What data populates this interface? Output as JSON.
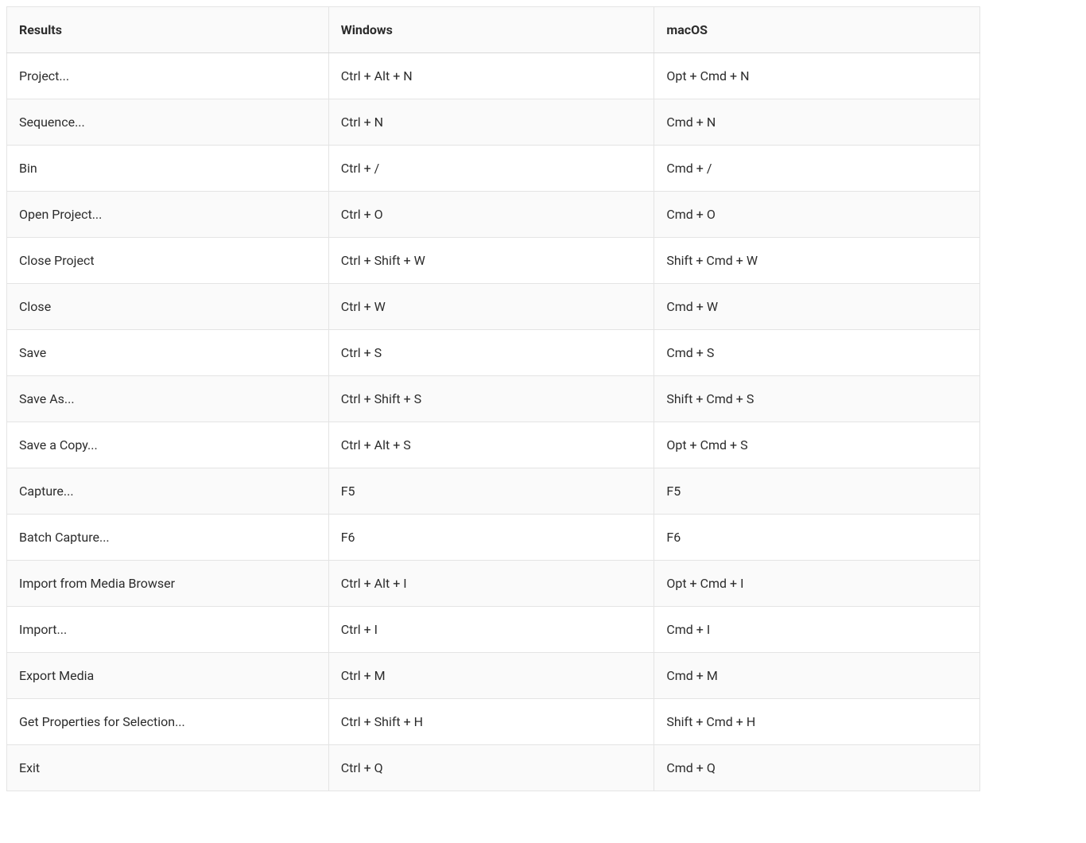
{
  "table": {
    "headers": {
      "results": "Results",
      "windows": "Windows",
      "macos": "macOS"
    },
    "rows": [
      {
        "results": "Project...",
        "windows": "Ctrl + Alt + N",
        "macos": "Opt + Cmd + N"
      },
      {
        "results": "Sequence...",
        "windows": "Ctrl + N",
        "macos": "Cmd + N"
      },
      {
        "results": "Bin",
        "windows": "Ctrl + /",
        "macos": "Cmd + /"
      },
      {
        "results": "Open Project...",
        "windows": "Ctrl + O",
        "macos": "Cmd + O"
      },
      {
        "results": "Close Project",
        "windows": "Ctrl + Shift + W",
        "macos": "Shift + Cmd + W"
      },
      {
        "results": "Close",
        "windows": "Ctrl + W",
        "macos": "Cmd + W"
      },
      {
        "results": "Save",
        "windows": "Ctrl + S",
        "macos": "Cmd + S"
      },
      {
        "results": "Save As...",
        "windows": "Ctrl + Shift + S",
        "macos": "Shift + Cmd + S"
      },
      {
        "results": "Save a Copy...",
        "windows": "Ctrl + Alt + S",
        "macos": "Opt + Cmd + S"
      },
      {
        "results": "Capture...",
        "windows": "F5",
        "macos": "F5"
      },
      {
        "results": "Batch Capture...",
        "windows": "F6",
        "macos": "F6"
      },
      {
        "results": "Import from Media Browser",
        "windows": "Ctrl + Alt + I",
        "macos": "Opt + Cmd + I"
      },
      {
        "results": "Import...",
        "windows": "Ctrl + I",
        "macos": "Cmd + I"
      },
      {
        "results": "Export Media",
        "windows": "Ctrl + M",
        "macos": "Cmd + M"
      },
      {
        "results": "Get Properties for Selection...",
        "windows": "Ctrl + Shift + H",
        "macos": "Shift + Cmd + H"
      },
      {
        "results": "Exit",
        "windows": "Ctrl + Q",
        "macos": "Cmd + Q"
      }
    ]
  }
}
